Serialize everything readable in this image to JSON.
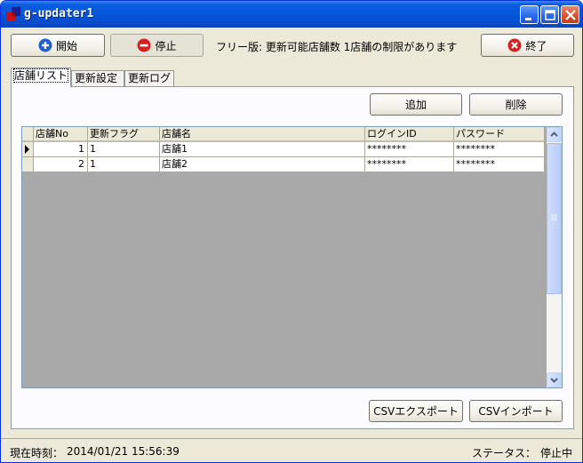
{
  "window": {
    "title": "g-updater1"
  },
  "toolbar": {
    "start_label": "開始",
    "stop_label": "停止",
    "notice": "フリー版: 更新可能店舗数 1店舗の制限があります",
    "exit_label": "終了"
  },
  "tabs": [
    {
      "label": "店舗リスト",
      "active": true
    },
    {
      "label": "更新設定",
      "active": false
    },
    {
      "label": "更新ログ",
      "active": false
    }
  ],
  "actions": {
    "add_label": "追加",
    "delete_label": "削除"
  },
  "table": {
    "columns": [
      "店舗No",
      "更新フラグ",
      "店舗名",
      "ログインID",
      "パスワード"
    ],
    "rows": [
      [
        "1",
        "1",
        "店舗1",
        "********",
        "********"
      ],
      [
        "2",
        "1",
        "店舗2",
        "********",
        "********"
      ]
    ]
  },
  "bottom_actions": {
    "csv_export_label": "CSVエクスポート",
    "csv_import_label": "CSVインポート"
  },
  "statusbar": {
    "time_label": "現在時刻：",
    "time_value": "2014/01/21 15:56:39",
    "status_label": "ステータス：",
    "status_value": "停止中"
  },
  "colors": {
    "titlebar": "#0552d6",
    "window_bg": "#ece9d8",
    "start_icon": "#1c5fd6",
    "stop_icon": "#d42222",
    "exit_icon": "#d42222"
  },
  "icons": {
    "start": "play-circle-icon",
    "stop": "stop-circle-icon",
    "exit": "close-circle-icon"
  }
}
